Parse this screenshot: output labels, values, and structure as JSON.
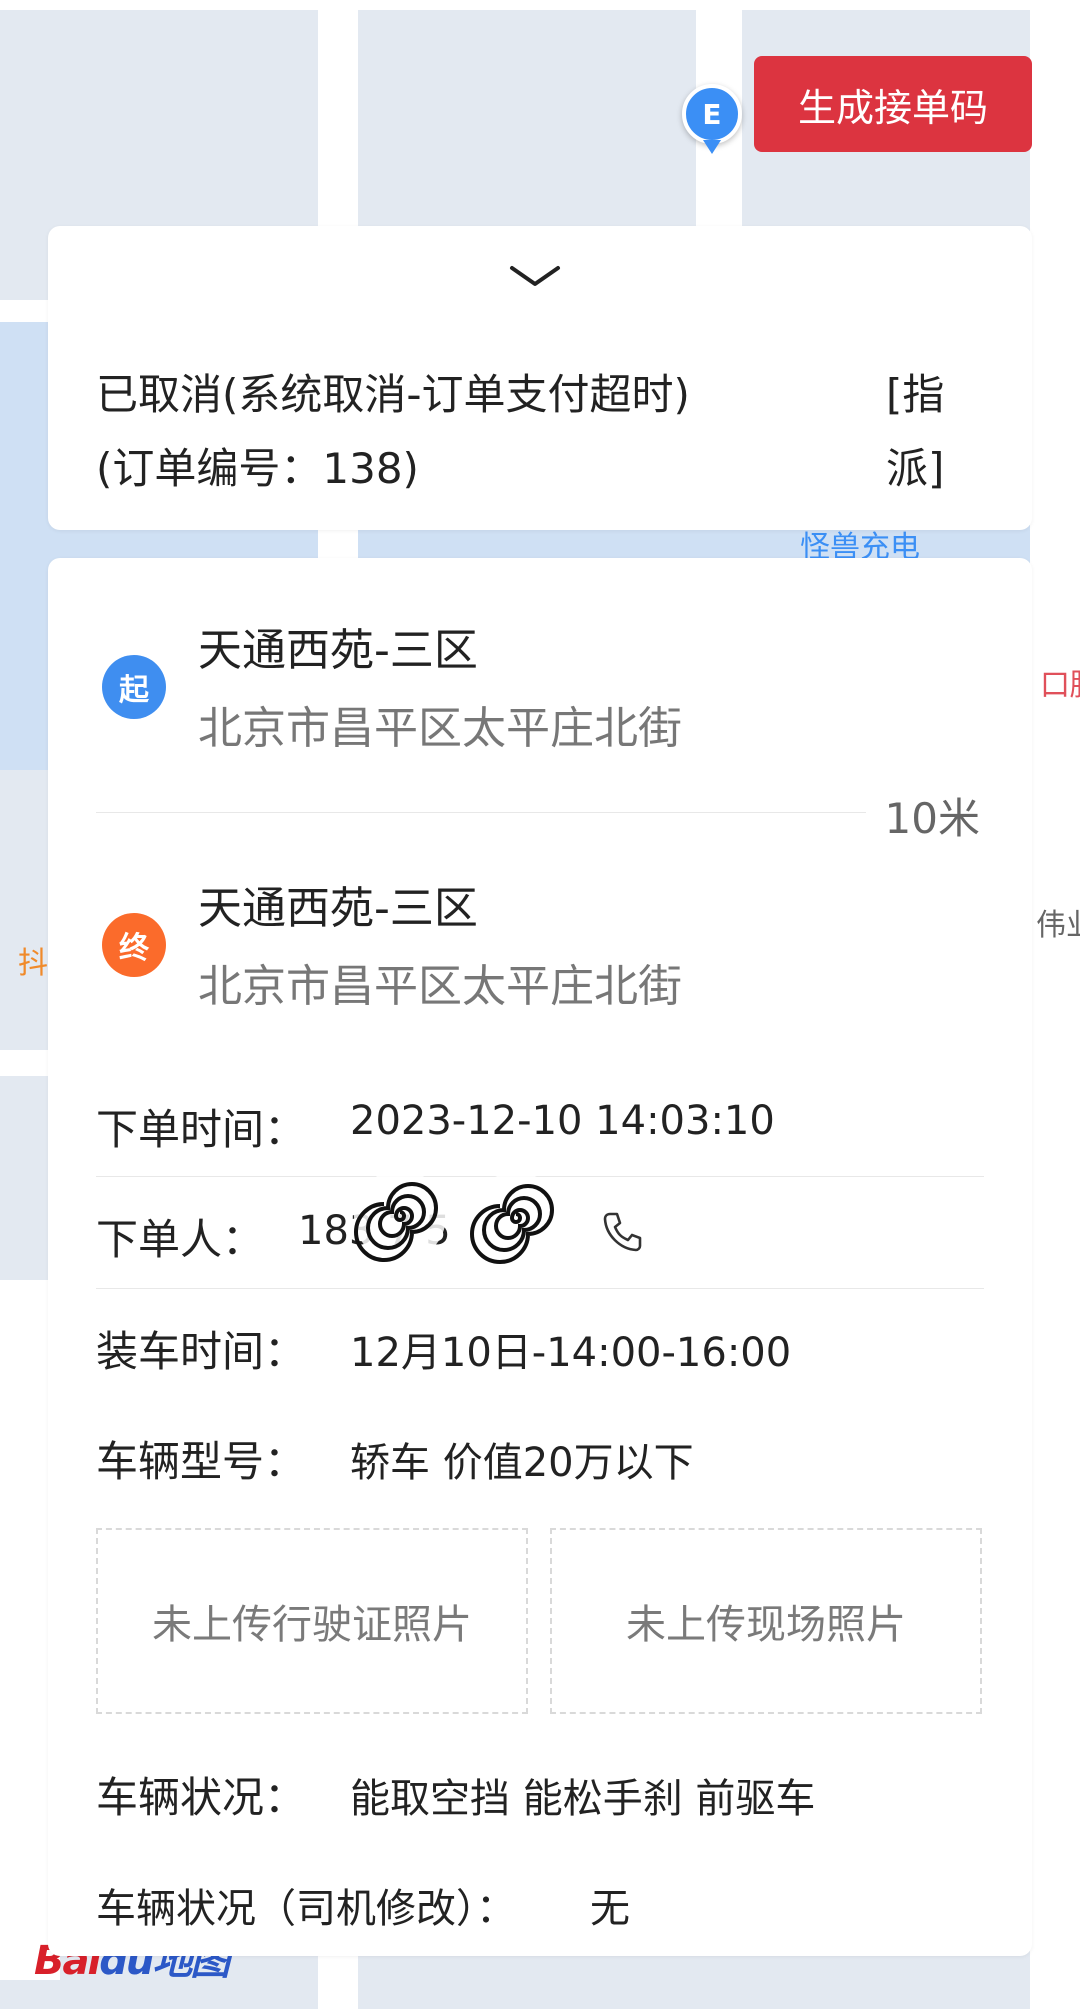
{
  "map": {
    "poi_charging": "怪兽充电",
    "poi_right_top": "口腔",
    "poi_right_mid": "伟业",
    "poi_left_mid": "抖",
    "logo_text_red": "Bai",
    "logo_text_blue": "du地图"
  },
  "toolbar": {
    "generate_code_label": "生成接单码"
  },
  "status": {
    "line1": "已取消(系统取消-订单支付超时)",
    "line2": "(订单编号：138)",
    "assign_tag": "[指派]"
  },
  "route": {
    "start_badge": "起",
    "start_name": "天通西苑-三区",
    "start_address": "北京市昌平区太平庄北街",
    "distance": "10米",
    "end_badge": "终",
    "end_name": "天通西苑-三区",
    "end_address": "北京市昌平区太平庄北街"
  },
  "details": {
    "order_time_label": "下单时间：",
    "order_time_value": "2023-12-10 14:03:10",
    "orderer_label": "下单人：",
    "orderer_value": "183   7   5",
    "loading_time_label": "装车时间：",
    "loading_time_value": "12月10日-14:00-16:00",
    "vehicle_model_label": "车辆型号：",
    "vehicle_model_value": "轿车 价值20万以下",
    "photo_license": "未上传行驶证照片",
    "photo_scene": "未上传现场照片",
    "vehicle_condition_label": "车辆状况：",
    "vehicle_condition_value": "能取空挡 能松手刹 前驱车",
    "driver_condition_label": "车辆状况（司机修改）：",
    "driver_condition_value": "无"
  },
  "colors": {
    "button_red": "#dc3440",
    "start_blue": "#3f8ef0",
    "end_orange": "#fb6b2b"
  },
  "icons": [
    "chevron-down-icon",
    "phone-icon",
    "map-poi-icon"
  ]
}
